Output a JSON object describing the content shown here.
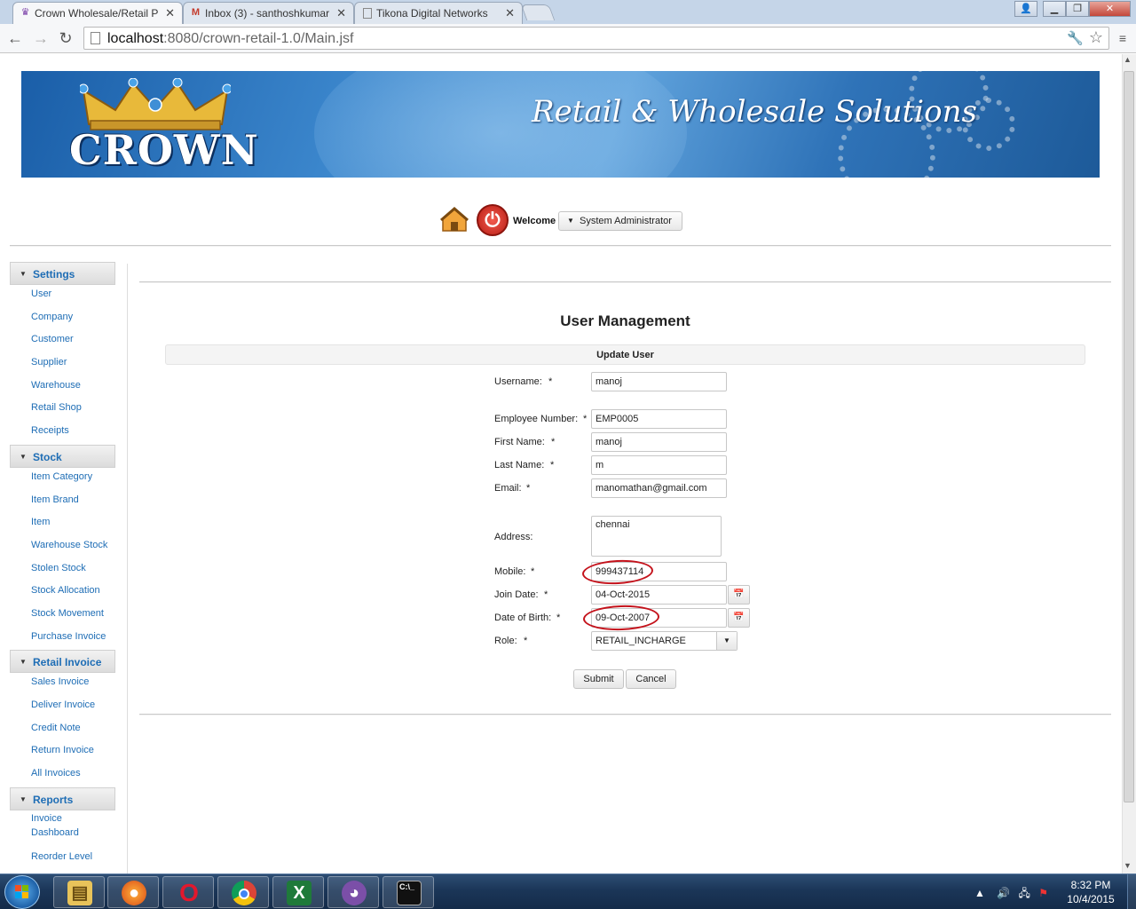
{
  "browser": {
    "tabs": [
      {
        "label": "Crown Wholesale/Retail P",
        "icon": "crown-favicon"
      },
      {
        "label": "Inbox (3) - santhoshkumar",
        "icon": "gmail-icon"
      },
      {
        "label": "Tikona Digital Networks",
        "icon": "page-icon"
      }
    ],
    "url_host": "localhost",
    "url_path": ":8080/crown-retail-1.0/Main.jsf"
  },
  "banner": {
    "logo_text": "CROWN",
    "tagline": "Retail & Wholesale Solutions"
  },
  "userbar": {
    "welcome_label": "Welcome",
    "user_menu_label": "System Administrator"
  },
  "sidebar": {
    "sections": [
      {
        "title": "Settings",
        "items": [
          "User",
          "Company",
          "Customer",
          "Supplier",
          "Warehouse",
          "Retail Shop",
          "Receipts"
        ]
      },
      {
        "title": "Stock",
        "items": [
          "Item Category",
          "Item Brand",
          "Item",
          "Warehouse Stock",
          "Stolen Stock",
          "Stock Allocation",
          "Stock Movement",
          "Purchase Invoice"
        ]
      },
      {
        "title": "Retail Invoice",
        "items": [
          "Sales Invoice",
          "Deliver Invoice",
          "Credit Note",
          "Return Invoice",
          "All Invoices"
        ]
      },
      {
        "title": "Reports",
        "items": [
          "Invoice Dashboard",
          "Reorder Level"
        ]
      }
    ]
  },
  "form": {
    "page_title": "User Management",
    "panel_title": "Update User",
    "required_marker": "*",
    "fields": {
      "username": {
        "label": "Username:",
        "value": "manoj"
      },
      "employee_number": {
        "label": "Employee Number:",
        "value": "EMP0005"
      },
      "first_name": {
        "label": "First Name:",
        "value": "manoj"
      },
      "last_name": {
        "label": "Last Name:",
        "value": "m"
      },
      "email": {
        "label": "Email:",
        "value": "manomathan@gmail.com"
      },
      "address": {
        "label": "Address:",
        "value": "chennai"
      },
      "mobile": {
        "label": "Mobile:",
        "value": "999437114"
      },
      "join_date": {
        "label": "Join Date:",
        "value": "04-Oct-2015"
      },
      "date_of_birth": {
        "label": "Date of Birth:",
        "value": "09-Oct-2007"
      },
      "role": {
        "label": "Role:",
        "value": "RETAIL_INCHARGE"
      }
    },
    "submit_label": "Submit",
    "cancel_label": "Cancel"
  },
  "taskbar": {
    "apps": [
      "explorer-icon",
      "firefox-icon",
      "opera-icon",
      "chrome-icon",
      "excel-icon",
      "github-icon",
      "cmd-icon"
    ],
    "cmd_text": "C:\\_",
    "time": "8:32 PM",
    "date": "10/4/2015"
  },
  "colors": {
    "link_blue": "#1e6db5",
    "annotation_red": "#c4121b",
    "banner_blue": "#2f73b8"
  }
}
